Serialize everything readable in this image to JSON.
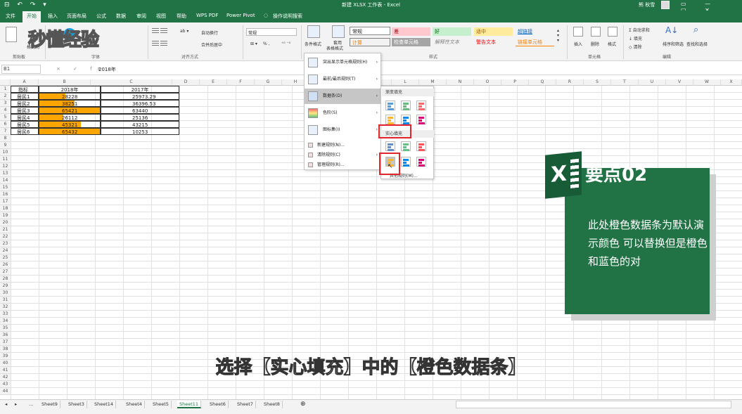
{
  "window": {
    "title": "新建 XLSX 工作表 - Excel",
    "user": "熊 秋雪",
    "qa_icons": "⊟ ↶ ↷ ▾"
  },
  "tabs": [
    {
      "label": "文件"
    },
    {
      "label": "开始"
    },
    {
      "label": "插入"
    },
    {
      "label": "页面布局"
    },
    {
      "label": "公式"
    },
    {
      "label": "数据"
    },
    {
      "label": "审阅"
    },
    {
      "label": "视图"
    },
    {
      "label": "帮助"
    },
    {
      "label": "WPS PDF"
    },
    {
      "label": "Power Pivot"
    },
    {
      "label": "操作说明搜索"
    }
  ],
  "ribbon": {
    "groups": {
      "clipboard": "剪贴板",
      "font": "字体",
      "alignment": "对齐方式",
      "styles": "样式",
      "cells": "单元格",
      "editing": "编辑"
    },
    "wrap_text": "自动换行",
    "merge_center": "合并后居中",
    "number_format": "常规",
    "percent_symbol": "% ,",
    "conditional_format": "条件格式",
    "format_table": "套用",
    "format_table_2": "表格格式",
    "styles": {
      "normal": "常规",
      "bad": "差",
      "good": "好",
      "neutral": "适中",
      "hyperlink": "超链接",
      "calc": "计算",
      "check": "检查单元格",
      "explanatory": "解释性文本",
      "warning": "警告文本",
      "followed": "链接单元格"
    },
    "insert": "插入",
    "delete": "删除",
    "format": "格式",
    "autosum": "自动求和",
    "fill": "填充",
    "clear": "清除",
    "sort_filter": "排序和筛选",
    "find_select": "查找和选择",
    "format_painter": "格式刷"
  },
  "watermark": "秒懂经验",
  "formula_bar": {
    "name_box": "B1",
    "fx_icons": "× ✓ fx",
    "formula": "2018年"
  },
  "columns": [
    "A",
    "B",
    "C",
    "D",
    "E",
    "F",
    "G",
    "H",
    "I",
    "J",
    "K",
    "L",
    "M",
    "N",
    "O",
    "P",
    "Q",
    "R",
    "S",
    "T",
    "U",
    "V",
    "W",
    "X"
  ],
  "rows": [
    "1",
    "2",
    "3",
    "4",
    "5",
    "6",
    "7",
    "8",
    "9",
    "10",
    "11",
    "12",
    "13",
    "14",
    "15",
    "16",
    "17",
    "18",
    "19",
    "20",
    "21",
    "22",
    "23",
    "24",
    "25",
    "26",
    "27",
    "28",
    "29",
    "30",
    "31",
    "32",
    "33",
    "34",
    "35",
    "36",
    "37",
    "38",
    "39",
    "40",
    "41",
    "42",
    "43",
    "44"
  ],
  "table": {
    "header": [
      "指标",
      "2018年",
      "2017年"
    ],
    "rows": [
      {
        "label": "居民1",
        "v2018": "28228",
        "v2017": "25973.29",
        "bar": 0.43
      },
      {
        "label": "居民2",
        "v2018": "38251",
        "v2017": "36396.53",
        "bar": 0.58
      },
      {
        "label": "居民3",
        "v2018": "65421",
        "v2017": "63440",
        "bar": 1.0
      },
      {
        "label": "居民4",
        "v2018": "26112",
        "v2017": "25136",
        "bar": 0.4
      },
      {
        "label": "居民5",
        "v2018": "45321",
        "v2017": "43215",
        "bar": 0.69
      },
      {
        "label": "居民6",
        "v2018": "65432",
        "v2017": "10253",
        "bar": 1.0
      }
    ]
  },
  "cf_menu": {
    "highlight_rules": "突出显示单元格规则(H)",
    "top_bottom": "最前/最后规则(T)",
    "data_bars": "数据条(D)",
    "color_scales": "色阶(S)",
    "icon_sets": "图标集(I)",
    "new_rule": "新建规则(N)...",
    "clear_rules": "清除规则(C)",
    "manage_rules": "管理规则(R)..."
  },
  "data_bar_menu": {
    "gradient_fill": "渐变填充",
    "solid_fill": "实心填充",
    "more_rules": "其他规则(M)..."
  },
  "note": {
    "heading": "要点02",
    "x": "X",
    "text": "此处橙色数据条为默认演示颜色  可以替换但是橙色和蓝色的对"
  },
  "subtitle": "选择【实心填充】中的【橙色数据条】",
  "sheets": {
    "ellipsis": "...",
    "tabs": [
      "Sheet9",
      "Sheet3",
      "Sheet14",
      "Sheet4",
      "Sheet5",
      "Sheet11",
      "Sheet6",
      "Sheet7",
      "Sheet8"
    ],
    "active": "Sheet11",
    "add": "⊕"
  },
  "colors": {
    "excel_green": "#217346",
    "data_bar": "#FFA500",
    "highlight_red": "#E3242B"
  }
}
